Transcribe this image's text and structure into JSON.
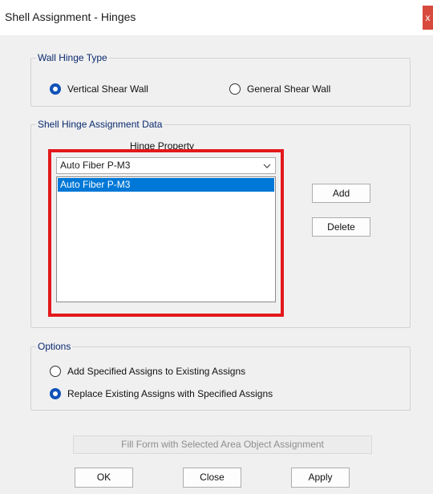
{
  "window": {
    "title": "Shell Assignment - Hinges",
    "close_glyph": "x"
  },
  "wall_hinge_type": {
    "legend": "Wall Hinge Type",
    "options": [
      {
        "label": "Vertical Shear Wall",
        "checked": true
      },
      {
        "label": "General Shear Wall",
        "checked": false
      }
    ]
  },
  "assignment_data": {
    "legend": "Shell Hinge Assignment Data",
    "hinge_property_label": "Hinge Property",
    "dropdown": {
      "selected": "Auto Fiber P-M3",
      "arrow_icon": "chevron-down-icon"
    },
    "list_items": [
      {
        "label": "Auto Fiber P-M3",
        "selected": true
      }
    ],
    "add_label": "Add",
    "delete_label": "Delete",
    "highlight_color": "#e3181b"
  },
  "options": {
    "legend": "Options",
    "choices": [
      {
        "label": "Add Specified Assigns to Existing Assigns",
        "checked": false
      },
      {
        "label": "Replace Existing Assigns with Specified Assigns",
        "checked": true
      }
    ]
  },
  "footer": {
    "fill_form_label": "Fill Form with Selected Area Object Assignment",
    "fill_form_enabled": false,
    "ok_label": "OK",
    "close_label": "Close",
    "apply_label": "Apply"
  },
  "colors": {
    "radio_checked": "#0f52b8",
    "list_selection": "#0078d7",
    "legend_text": "#0a2a6e",
    "close_button": "#d84a3e"
  }
}
